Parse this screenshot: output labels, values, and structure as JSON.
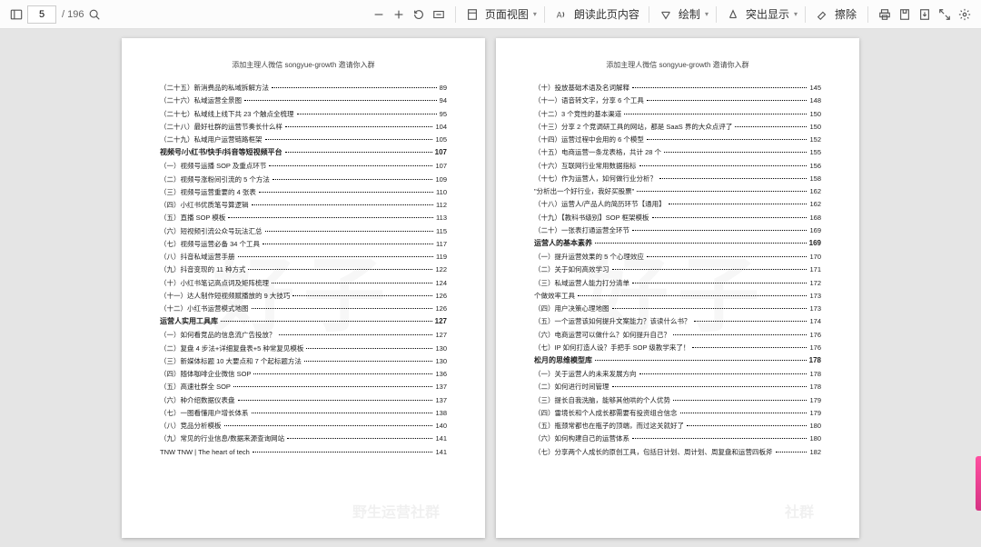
{
  "toolbar": {
    "current_page": "5",
    "total_pages": "/ 196",
    "page_view": "页面视图",
    "read_aloud": "朗读此页内容",
    "draw": "绘制",
    "highlight": "突出显示",
    "erase": "擦除"
  },
  "header_text": "添加主理人微信 songyue-growth 邀请你入群",
  "watermark": "好子",
  "watermark_footer_left": "野生运营社群",
  "watermark_footer_right": "社群",
  "left_toc": [
    {
      "t": "（二十五）新消费品的私域拆解方法",
      "p": "89",
      "b": false
    },
    {
      "t": "（二十六）私域运营全景图",
      "p": "94",
      "b": false
    },
    {
      "t": "（二十七）私域线上线下共 23 个触点全梳理",
      "p": "95",
      "b": false
    },
    {
      "t": "（二十八）最好社群的运营节奏长什么样",
      "p": "104",
      "b": false
    },
    {
      "t": "（二十九）私域用户运营链路框架",
      "p": "105",
      "b": false
    },
    {
      "t": "视频号/小红书/快手/抖音等短视频平台",
      "p": "107",
      "b": true
    },
    {
      "t": "（一）视频号运播 SOP 及重点环节",
      "p": "107",
      "b": false
    },
    {
      "t": "（二）视频号涨粉间引流的 5 个方法",
      "p": "109",
      "b": false
    },
    {
      "t": "（三）视频号运营重要的 4 张表",
      "p": "110",
      "b": false
    },
    {
      "t": "（四）小红书优质笔号算逻辑",
      "p": "112",
      "b": false
    },
    {
      "t": "（五）直播 SOP 模板",
      "p": "113",
      "b": false
    },
    {
      "t": "（六）短视频引流公众号玩法汇总",
      "p": "115",
      "b": false
    },
    {
      "t": "（七）视频号运营必备 34 个工具",
      "p": "117",
      "b": false
    },
    {
      "t": "（八）抖音私域运营手册",
      "p": "119",
      "b": false
    },
    {
      "t": "（九）抖音变现的 11 种方式",
      "p": "122",
      "b": false
    },
    {
      "t": "（十）小红书笔记高点词及矩阵梳理",
      "p": "124",
      "b": false
    },
    {
      "t": "（十一）达人制作短视频赋播放的 9 大技巧",
      "p": "126",
      "b": false
    },
    {
      "t": "（十二）小红书运营模式地图",
      "p": "126",
      "b": false
    },
    {
      "t": "运营人实用工具库",
      "p": "127",
      "b": true
    },
    {
      "t": "（一）如何看竞品的信息流广告投放？",
      "p": "127",
      "b": false
    },
    {
      "t": "（二）复盘 4 步法+详细复盘表+5 种常复见模板",
      "p": "130",
      "b": false
    },
    {
      "t": "（三）新媒体标题 10 大要点和 7 个起标题方法",
      "p": "130",
      "b": false
    },
    {
      "t": "（四）随体咖啡企业微信 SOP",
      "p": "136",
      "b": false
    },
    {
      "t": "（五）高速社群全 SOP",
      "p": "137",
      "b": false
    },
    {
      "t": "（六）种介绍数据仪表盘",
      "p": "137",
      "b": false
    },
    {
      "t": "（七）一图看懂用户增长体系",
      "p": "138",
      "b": false
    },
    {
      "t": "（八）竞品分析模板",
      "p": "140",
      "b": false
    },
    {
      "t": "（九）常见的行业信息/数据来源查询网站",
      "p": "141",
      "b": false
    },
    {
      "t": "TNW TNW | The heart of tech",
      "p": "141",
      "b": false
    }
  ],
  "right_toc": [
    {
      "t": "（十）投放基础术语及名词解释",
      "p": "145",
      "b": false
    },
    {
      "t": "（十一）语音转文字，分享 6 个工具",
      "p": "148",
      "b": false
    },
    {
      "t": "（十二）3 个竞性的基本渠道",
      "p": "150",
      "b": false
    },
    {
      "t": "（十三）分享 2 个竞调研工具的网站，都是 SaaS 界的大众点评了",
      "p": "150",
      "b": false
    },
    {
      "t": "（十四）运营过程中会用的 6 个模型",
      "p": "152",
      "b": false
    },
    {
      "t": "（十五）电商运营一条龙表格，共计 28 个",
      "p": "155",
      "b": false
    },
    {
      "t": "（十六）互联网行业常用数据指标",
      "p": "156",
      "b": false
    },
    {
      "t": "（十七）作为运营人，如何做行业分析？",
      "p": "158",
      "b": false
    },
    {
      "t": "\"分析出一个好行业，我好买股票\"",
      "p": "162",
      "b": false
    },
    {
      "t": "（十八）运营人/产品人的简历环节【通用】",
      "p": "162",
      "b": false
    },
    {
      "t": "（十九）【教科书级别】SOP 框架模板",
      "p": "168",
      "b": false
    },
    {
      "t": "（二十）一张表打通运营全环节",
      "p": "169",
      "b": false
    },
    {
      "t": "运营人的基本素养",
      "p": "169",
      "b": true
    },
    {
      "t": "（一）提升运营效果的 5 个心理效应",
      "p": "170",
      "b": false
    },
    {
      "t": "（二）关于如何高效学习",
      "p": "171",
      "b": false
    },
    {
      "t": "（三）私域运营人能力打分清单",
      "p": "172",
      "b": false
    },
    {
      "t": "个做效率工具",
      "p": "173",
      "b": false
    },
    {
      "t": "（四）用户决策心理地图",
      "p": "173",
      "b": false
    },
    {
      "t": "（五）一个运营该如何提升文案能力？该读什么书？",
      "p": "174",
      "b": false
    },
    {
      "t": "（六）电商运营可以做什么？如何提升自己？",
      "p": "176",
      "b": false
    },
    {
      "t": "（七）IP 如何打造人设？手把手 SOP 级教学来了！",
      "p": "176",
      "b": false
    },
    {
      "t": "松月的思维模型库",
      "p": "178",
      "b": true
    },
    {
      "t": "（一）关于运营人的未来发展方向",
      "p": "178",
      "b": false
    },
    {
      "t": "（二）如何进行时间管理",
      "p": "178",
      "b": false
    },
    {
      "t": "（三）提长自我洗脑，能够其他哄的个人优势",
      "p": "179",
      "b": false
    },
    {
      "t": "（四）雷境长和个人成长都需要有投资组合信念",
      "p": "179",
      "b": false
    },
    {
      "t": "（五）瓶颈常都也在瓶子的顶端，而过这关就好了",
      "p": "180",
      "b": false
    },
    {
      "t": "（六）如何构建自己的运营体系",
      "p": "180",
      "b": false
    },
    {
      "t": "（七）分享两个人成长的原创工具，包括日计划、周计划、周复盘和运营四板斧",
      "p": "182",
      "b": false
    }
  ]
}
